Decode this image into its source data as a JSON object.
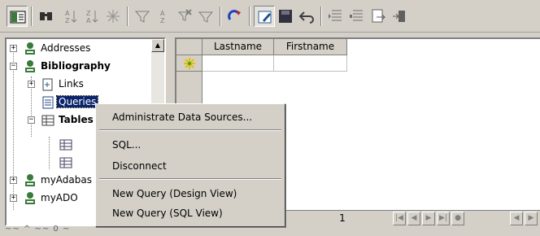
{
  "toolbar": {
    "buttons": [
      {
        "name": "data-source-explorer-icon",
        "pressed": true
      },
      {
        "name": "find-record-icon"
      },
      {
        "name": "sort-ascending-icon"
      },
      {
        "name": "sort-descending-icon"
      },
      {
        "name": "autofilter-icon"
      },
      {
        "name": "apply-filter-icon"
      },
      {
        "name": "sort-icon"
      },
      {
        "name": "remove-filter-icon"
      },
      {
        "name": "filter-icon"
      },
      {
        "name": "refresh-icon"
      },
      {
        "name": "edit-data-icon",
        "pressed": true
      },
      {
        "name": "save-record-icon"
      },
      {
        "name": "undo-icon"
      },
      {
        "name": "insert-column-icon"
      },
      {
        "name": "data-to-fields-icon"
      },
      {
        "name": "data-to-text-icon"
      },
      {
        "name": "mail-merge-icon"
      }
    ]
  },
  "tree": {
    "items": [
      {
        "label": "Addresses",
        "expander": "+",
        "icon": "database-icon"
      },
      {
        "label": "Bibliography",
        "expander": "−",
        "icon": "database-icon",
        "bold": true
      },
      {
        "label": "Links",
        "expander": "+",
        "icon": "links-icon"
      },
      {
        "label": "Queries",
        "icon": "query-icon",
        "selected": true
      },
      {
        "label": "Tables",
        "expander": "−",
        "icon": "tables-icon",
        "bold": true
      },
      {
        "label": "",
        "icon": "table-icon"
      },
      {
        "label": "",
        "icon": "table-icon"
      },
      {
        "label": "myAdabas",
        "expander": "+",
        "icon": "database-icon"
      },
      {
        "label": "myADO",
        "expander": "+",
        "icon": "database-icon"
      }
    ],
    "hscroll_text": "~~ ^ ~~ 0 ~"
  },
  "grid": {
    "columns": [
      "Lastname",
      "Firstname"
    ],
    "record_number": "1"
  },
  "context_menu": {
    "items": [
      {
        "label": "Administrate Data Sources..."
      },
      {
        "label": "SQL..."
      },
      {
        "label": "Disconnect"
      },
      {
        "label": "New Query (Design View)"
      },
      {
        "label": "New Query (SQL View)"
      }
    ]
  },
  "colors": {
    "face": "#d4d0c8",
    "selection": "#0a246a",
    "database_icon": "#3a7a3a"
  }
}
